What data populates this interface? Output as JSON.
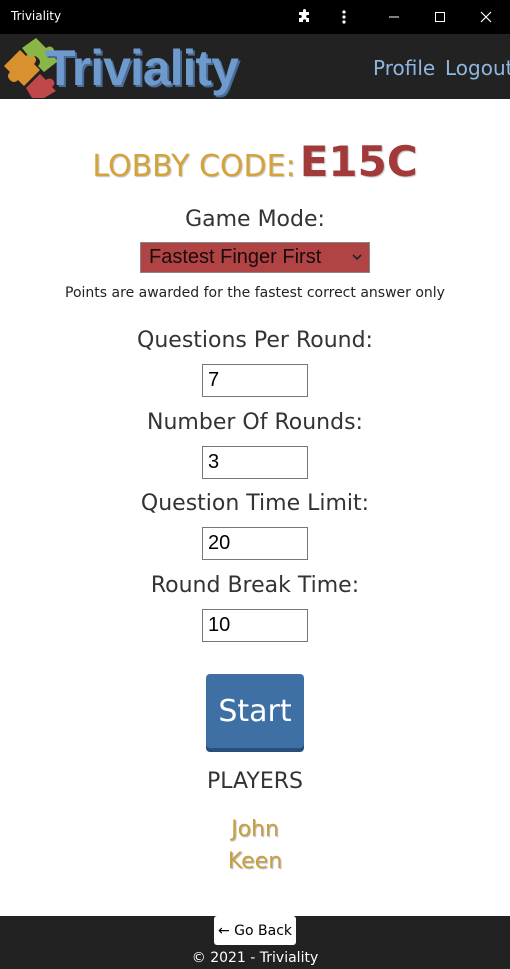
{
  "window": {
    "title": "Triviality",
    "controls": [
      "extensions-icon",
      "more-icon",
      "minimize-icon",
      "maximize-icon",
      "close-icon"
    ]
  },
  "header": {
    "logo_text": "Triviality",
    "nav": [
      {
        "label": "Profile"
      },
      {
        "label": "Logout"
      }
    ]
  },
  "lobby": {
    "label": "LOBBY CODE:",
    "code": "E15C"
  },
  "settings": {
    "game_mode_label": "Game Mode:",
    "game_mode_value": "Fastest Finger First",
    "game_mode_description": "Points are awarded for the fastest correct answer only",
    "fields": [
      {
        "label": "Questions Per Round:",
        "value": "7"
      },
      {
        "label": "Number Of Rounds:",
        "value": "3"
      },
      {
        "label": "Question Time Limit:",
        "value": "20"
      },
      {
        "label": "Round Break Time:",
        "value": "10"
      }
    ]
  },
  "start_label": "Start",
  "players": {
    "title": "PLAYERS",
    "names": [
      "John",
      "Keen"
    ]
  },
  "footer": {
    "back_label": "← Go Back",
    "copyright": "© 2021 - Triviality"
  },
  "colors": {
    "header_bg": "#222222",
    "lobby_label": "#d4a33a",
    "lobby_code": "#a33a3a",
    "select_bg": "#b04444",
    "start_button": "#3e70a6",
    "player_name": "#c9a040",
    "nav_link": "#8fb6e0"
  }
}
